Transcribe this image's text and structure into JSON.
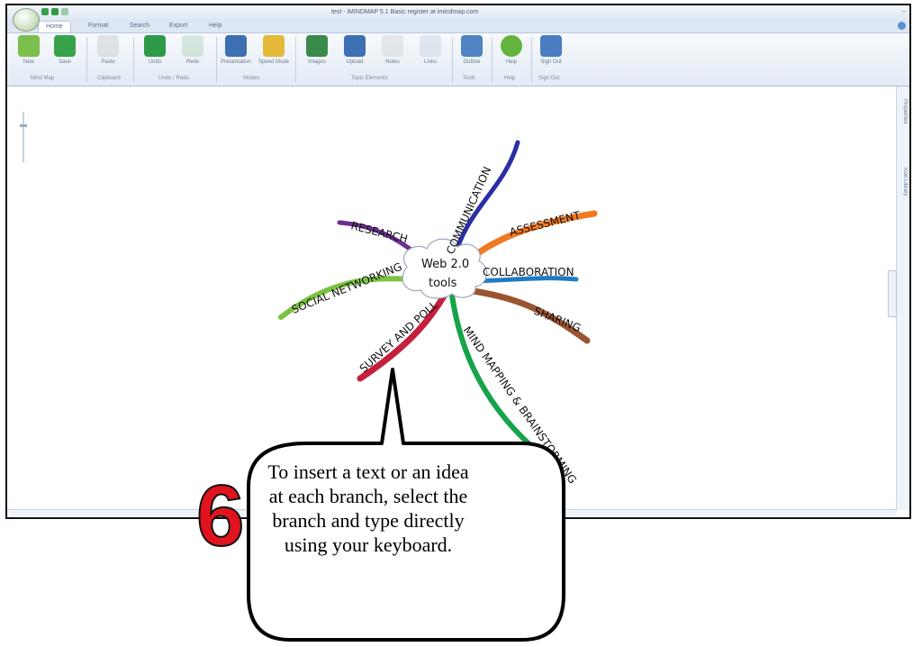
{
  "window": {
    "title": "test - iMINDMAP 5.1 Basic register at imindmap.com"
  },
  "tabs": [
    "Home",
    "Format",
    "Search",
    "Export",
    "Help"
  ],
  "ribbon": {
    "buttons": [
      {
        "label": "New",
        "icon": "new-mindmap-icon",
        "color": "#7bbf4d"
      },
      {
        "label": "Save",
        "icon": "save-icon",
        "color": "#37a24a"
      },
      {
        "label": "Paste",
        "icon": "paste-icon",
        "color": "#b9b9b9"
      },
      {
        "label": "Undo",
        "icon": "undo-icon",
        "color": "#2e9a48"
      },
      {
        "label": "Redo",
        "icon": "redo-icon",
        "color": "#9cc9a6"
      },
      {
        "label": "Presentation",
        "icon": "presentation-icon",
        "color": "#3d6fb3"
      },
      {
        "label": "Speed Mode",
        "icon": "speed-mode-icon",
        "color": "#e3b93a"
      },
      {
        "label": "Images",
        "icon": "images-icon",
        "color": "#3a8a4a"
      },
      {
        "label": "Upload",
        "icon": "upload-icon",
        "color": "#3d6fb3"
      },
      {
        "label": "Notes",
        "icon": "notes-icon",
        "color": "#c9c9c9"
      },
      {
        "label": "Links",
        "icon": "links-icon",
        "color": "#b7c7dd"
      },
      {
        "label": "Outline",
        "icon": "outline-icon",
        "color": "#4f83c4"
      },
      {
        "label": "Help",
        "icon": "help-icon",
        "color": "#63b33c"
      },
      {
        "label": "Sign Out",
        "icon": "sign-out-icon",
        "color": "#4a7cc2"
      }
    ],
    "groups": [
      "Mind Map",
      "Clipboard",
      "Undo / Redo",
      "Modes",
      "Topic Elements",
      "Tools",
      "Help",
      "Sign Out"
    ]
  },
  "side_panel": {
    "tabs": [
      "Properties",
      "Icon Library"
    ]
  },
  "mindmap": {
    "central_idea": {
      "line1": "Web 2.0",
      "line2": "tools"
    },
    "branches": [
      {
        "label": "COMMUNICATION",
        "color": "#2a2fa4"
      },
      {
        "label": "ASSESSMENT",
        "color": "#f07a22"
      },
      {
        "label": "COLLABORATION",
        "color": "#1e7cc4"
      },
      {
        "label": "SHARING",
        "color": "#9b5431"
      },
      {
        "label": "MIND MAPPING & BRAINSTORMING",
        "color": "#16a34a"
      },
      {
        "label": "SURVEY AND POLL",
        "color": "#c4203c"
      },
      {
        "label": "SOCIAL NETWORKING",
        "color": "#7cc242"
      },
      {
        "label": "RESEARCH",
        "color": "#6b2f91"
      }
    ]
  },
  "callout": {
    "step_number": "6",
    "text": "To insert a text or an idea at each branch, select the branch and type directly using your keyboard.",
    "number_color": "#e0141e"
  }
}
